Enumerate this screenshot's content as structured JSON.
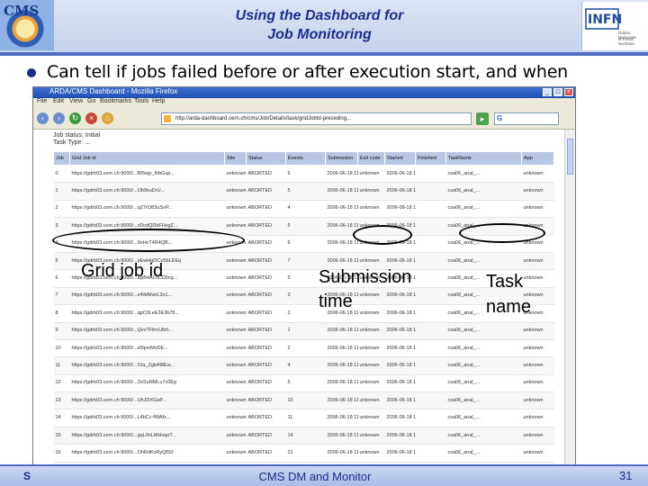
{
  "slide": {
    "title_line1": "Using the Dashboard for",
    "title_line2": "Job Monitoring",
    "logo_left_text": "CMS",
    "logo_right_text": "INFN",
    "logo_right_sub1": "Istituto Nazionale",
    "logo_right_sub2": "di Fisica Nucleare",
    "bullet": "Can tell if jobs failed before or after execution start, and when",
    "footer_left": "S",
    "footer_center": "CMS DM and Monitor",
    "page_number": "31",
    "colors": {
      "header_bg": "#c6d3ee",
      "accent": "#4f6ec2",
      "title": "#1a2e8c"
    }
  },
  "browser": {
    "title": "ARDA/CMS Dashboard - Mozilla Firefox",
    "menu": [
      "File",
      "Edit",
      "View",
      "Go",
      "Bookmarks",
      "Tools",
      "Help"
    ],
    "url": "http://arda-dashboard.cern.ch/cms/Job/Details/task/gridJobId-preceding...",
    "page_heading1": "Job status: Initial",
    "page_heading2": "Task Type: ...",
    "table": {
      "headers": [
        "Job",
        "Grid Job id",
        "Site",
        "Status",
        "Events",
        "Submission",
        "Exit code",
        "Started",
        "Finished",
        "TaskName",
        "App"
      ],
      "rows": [
        [
          "0",
          "https://gdrb03.cern.ch:9000/...fR5ejp_IhbGsp...",
          "unknown",
          "ABORTED",
          "5",
          "2006-06-18 11:03:27",
          "unknown",
          "2006-06-18 11:04:02",
          "",
          "csa06_anal_...",
          "unknown"
        ],
        [
          "1",
          "https://gdrb03.cern.ch:9000/...fJb9kuDrU...",
          "unknown",
          "ABORTED",
          "5",
          "2006-06-18 11:03:37",
          "unknown",
          "2006-06-18 11:05:10",
          "",
          "csa06_anal_...",
          "unknown"
        ],
        [
          "2",
          "https://gdrb03.cern.ch:9000/...qZ7rO83uSnP...",
          "unknown",
          "ABORTED",
          "4",
          "2006-06-18 11:04:05",
          "unknown",
          "2006-06-18 11:06:22",
          "",
          "csa06_anal_...",
          "unknown"
        ],
        [
          "3",
          "https://gdrb03.cern.ch:9000/...zDcdQDbFHxgZ...",
          "unknown",
          "ABORTED",
          "5",
          "2006-06-18 11:04:41",
          "unknown",
          "2006-06-18 11:06:48",
          "",
          "csa06_anal_...",
          "unknown"
        ],
        [
          "4",
          "https://gdrb03.cern.ch:9000/...9nHcT4R4QB...",
          "unknown",
          "ABORTED",
          "6",
          "2006-06-18 11:05:03",
          "unknown",
          "2006-06-18 11:07:23",
          "",
          "csa06_anal_...",
          "unknown"
        ],
        [
          "5",
          "https://gdrb03.cern.ch:9000/...pEwHgDCvSbLEEq",
          "unknown",
          "ABORTED",
          "7",
          "2006-06-18 11:05:28",
          "unknown",
          "2006-06-18 11:08:04",
          "",
          "csa06_anal_...",
          "unknown"
        ],
        [
          "6",
          "https://gdrb03.cern.ch:9000/...EpB4AL0CD0vg...",
          "unknown",
          "ABORTED",
          "5",
          "2006-06-18 11:05:54",
          "unknown",
          "2006-06-18 11:08:41",
          "",
          "csa06_anal_...",
          "unknown"
        ],
        [
          "7",
          "https://gdrb03.cern.ch:9000/...z4WAfwrL3o1...",
          "unknown",
          "ABORTED",
          "3",
          "2006-06-18 11:06:20",
          "unknown",
          "2006-06-18 11:09:17",
          "",
          "csa06_anal_...",
          "unknown"
        ],
        [
          "8",
          "https://gdrb03.cern.ch:9000/...qpC0LeE3E3b78...",
          "unknown",
          "ABORTED",
          "2",
          "2006-06-18 11:06:46",
          "unknown",
          "2006-06-18 11:09:55",
          "",
          "csa06_anal_...",
          "unknown"
        ],
        [
          "9",
          "https://gdrb03.cern.ch:9000/...QvvTFihcUlbh...",
          "unknown",
          "ABORTED",
          "1",
          "2006-06-18 11:07:12",
          "unknown",
          "2006-06-18 11:10:30",
          "",
          "csa06_anal_...",
          "unknown"
        ],
        [
          "10",
          "https://gdrb03.cern.ch:9000/...s0lpmMvDE...",
          "unknown",
          "ABORTED",
          "2",
          "2006-06-18 11:07:38",
          "unknown",
          "2006-06-18 11:11:06",
          "",
          "csa06_anal_...",
          "unknown"
        ],
        [
          "11",
          "https://gdrb03.cern.ch:9000/...0Ja_ZgbAl8Ew...",
          "unknown",
          "ABORTED",
          "4",
          "2006-06-18 11:08:04",
          "unknown",
          "2006-06-18 11:11:42",
          "",
          "csa06_anal_...",
          "unknown"
        ],
        [
          "12",
          "https://gdrb03.cern.ch:9000/...ZeSuNMLu7c0Eg",
          "unknown",
          "ABORTED",
          "5",
          "2006-06-18 11:08:30",
          "unknown",
          "2006-06-18 11:12:18",
          "",
          "csa06_anal_...",
          "unknown"
        ],
        [
          "13",
          "https://gdrb03.cern.ch:9000/...UhJDXGaP...",
          "unknown",
          "ABORTED",
          "10",
          "2006-06-18 11:08:56",
          "unknown",
          "2006-06-18 11:12:54",
          "",
          "csa06_anal_...",
          "unknown"
        ],
        [
          "14",
          "https://gdrb03.cern.ch:9000/...L4bCc-fWAfx...",
          "unknown",
          "ABORTED",
          "11",
          "2006-06-18 11:09:22",
          "unknown",
          "2006-06-18 11:13:30",
          "",
          "csa06_anal_...",
          "unknown"
        ],
        [
          "15",
          "https://gdrb03.cern.ch:9000/...gqL0nLMHxqoT...",
          "unknown",
          "ABORTED",
          "14",
          "2006-06-18 11:09:48",
          "unknown",
          "2006-06-18 11:14:06",
          "",
          "csa06_anal_...",
          "unknown"
        ],
        [
          "16",
          "https://gdrb03.cern.ch:9000/...OhRdKvRyQfS0",
          "unknown",
          "ABORTED",
          "21",
          "2006-06-18 11:10:14",
          "unknown",
          "2006-06-18 11:14:42",
          "",
          "csa06_anal_...",
          "unknown"
        ],
        [
          "17",
          "https://gdrb03.cern.ch:9000/...T8LFw43pkZu...",
          "unknown",
          "ABORTED",
          "22",
          "2006-06-18 11:10:40",
          "unknown",
          "2006-06-18 11:15:18",
          "",
          "csa06_anal_...",
          "unknown"
        ]
      ]
    }
  },
  "annotations": {
    "grid_job_id": "Grid job id",
    "submission_line1": "Submission",
    "submission_line2": "time",
    "task_line1": "Task",
    "task_line2": "name"
  }
}
